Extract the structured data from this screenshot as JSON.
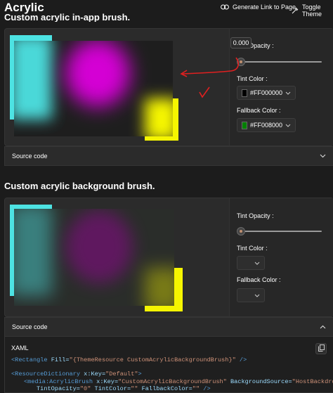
{
  "header": {
    "title": "Acrylic",
    "generate_link_label": "Generate Link to Page",
    "toggle_theme_label": "Toggle Theme"
  },
  "sections": [
    {
      "title": "Custom acrylic in-app brush.",
      "controls": {
        "opacity_label": "Tint Opacity :",
        "opacity_tooltip": "0.000",
        "opacity_value": 0,
        "tint_label": "Tint Color :",
        "tint_value": "#FF000000",
        "tint_swatch": "#000000",
        "fallback_label": "Fallback Color :",
        "fallback_value": "#FF008000",
        "fallback_swatch": "#008000"
      },
      "source_label": "Source code"
    },
    {
      "title": "Custom acrylic background brush.",
      "controls": {
        "opacity_label": "Tint Opacity :",
        "opacity_value": 0,
        "tint_label": "Tint Color :",
        "fallback_label": "Fallback Color :"
      },
      "source_label": "Source code",
      "code_language": "XAML",
      "code_lines": {
        "l1_tag": "<Rectangle",
        "l1_attr": " Fill=",
        "l1_str": "\"{ThemeResource CustomAcrylicBackgroundBrush}\"",
        "l1_end": " />",
        "l2_tag": "<ResourceDictionary",
        "l2_attr": " x:Key=",
        "l2_str": "\"Default\"",
        "l2_end": ">",
        "l3_tag": "<media:AcrylicBrush",
        "l3_attr1": " x:Key=",
        "l3_str1": "\"CustomAcrylicBackgroundBrush\"",
        "l3_attr2": " BackgroundSource=",
        "l3_str2": "\"HostBackdrop\"",
        "l4_attr1": "TintOpacity=",
        "l4_str1": "\"0\"",
        "l4_attr2": " TintColor=",
        "l4_str2": "\"\"",
        "l4_attr3": " FallbackColor=",
        "l4_str3": "\"\"",
        "l4_end": " />"
      }
    }
  ],
  "colors": {
    "accent_cyan": "#4de3e3",
    "accent_yellow": "#f5f500",
    "magenta": "#d400d4",
    "annotation_red": "#e02020"
  }
}
